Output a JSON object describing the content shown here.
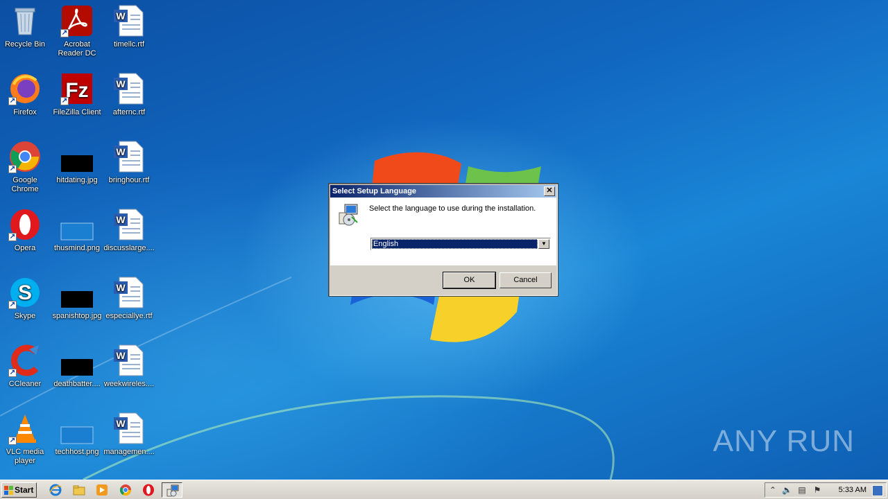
{
  "desktop": {
    "icons": [
      {
        "name": "recycle-bin-icon",
        "label": "Recycle Bin"
      },
      {
        "name": "acrobat-reader-icon",
        "label": "Acrobat Reader DC"
      },
      {
        "name": "rtf-document-icon",
        "label": "timellc.rtf"
      },
      {
        "name": "firefox-icon",
        "label": "Firefox"
      },
      {
        "name": "filezilla-icon",
        "label": "FileZilla Client"
      },
      {
        "name": "rtf-document-icon",
        "label": "afternc.rtf"
      },
      {
        "name": "chrome-icon",
        "label": "Google Chrome"
      },
      {
        "name": "image-thumbnail-icon",
        "label": "hitdating.jpg"
      },
      {
        "name": "rtf-document-icon",
        "label": "bringhour.rtf"
      },
      {
        "name": "opera-icon",
        "label": "Opera"
      },
      {
        "name": "image-thumbnail-icon",
        "label": "thusmind.png"
      },
      {
        "name": "rtf-document-icon",
        "label": "discusslarge...."
      },
      {
        "name": "skype-icon",
        "label": "Skype"
      },
      {
        "name": "image-thumbnail-icon",
        "label": "spanishtop.jpg"
      },
      {
        "name": "rtf-document-icon",
        "label": "especiallye.rtf"
      },
      {
        "name": "ccleaner-icon",
        "label": "CCleaner"
      },
      {
        "name": "image-thumbnail-icon",
        "label": "deathbatter...."
      },
      {
        "name": "rtf-document-icon",
        "label": "weekwireles...."
      },
      {
        "name": "vlc-icon",
        "label": "VLC media player"
      },
      {
        "name": "image-thumbnail-icon",
        "label": "techhost.png"
      },
      {
        "name": "rtf-document-icon",
        "label": "managemen...."
      }
    ],
    "watermark": "ANY RUN"
  },
  "dialog": {
    "title": "Select Setup Language",
    "close": "✕",
    "prompt": "Select the language to use during the installation.",
    "language_selected": "English",
    "ok_label": "OK",
    "cancel_label": "Cancel"
  },
  "taskbar": {
    "start_label": "Start",
    "pinned": [
      "internet-explorer-icon",
      "file-explorer-icon",
      "media-player-icon",
      "chrome-icon",
      "opera-icon",
      "setup-app-icon"
    ],
    "clock": "5:33 AM"
  },
  "colors": {
    "dialog_title_start": "#0a246a",
    "dialog_title_end": "#a6caf0",
    "desktop_blue": "#1378c9"
  }
}
